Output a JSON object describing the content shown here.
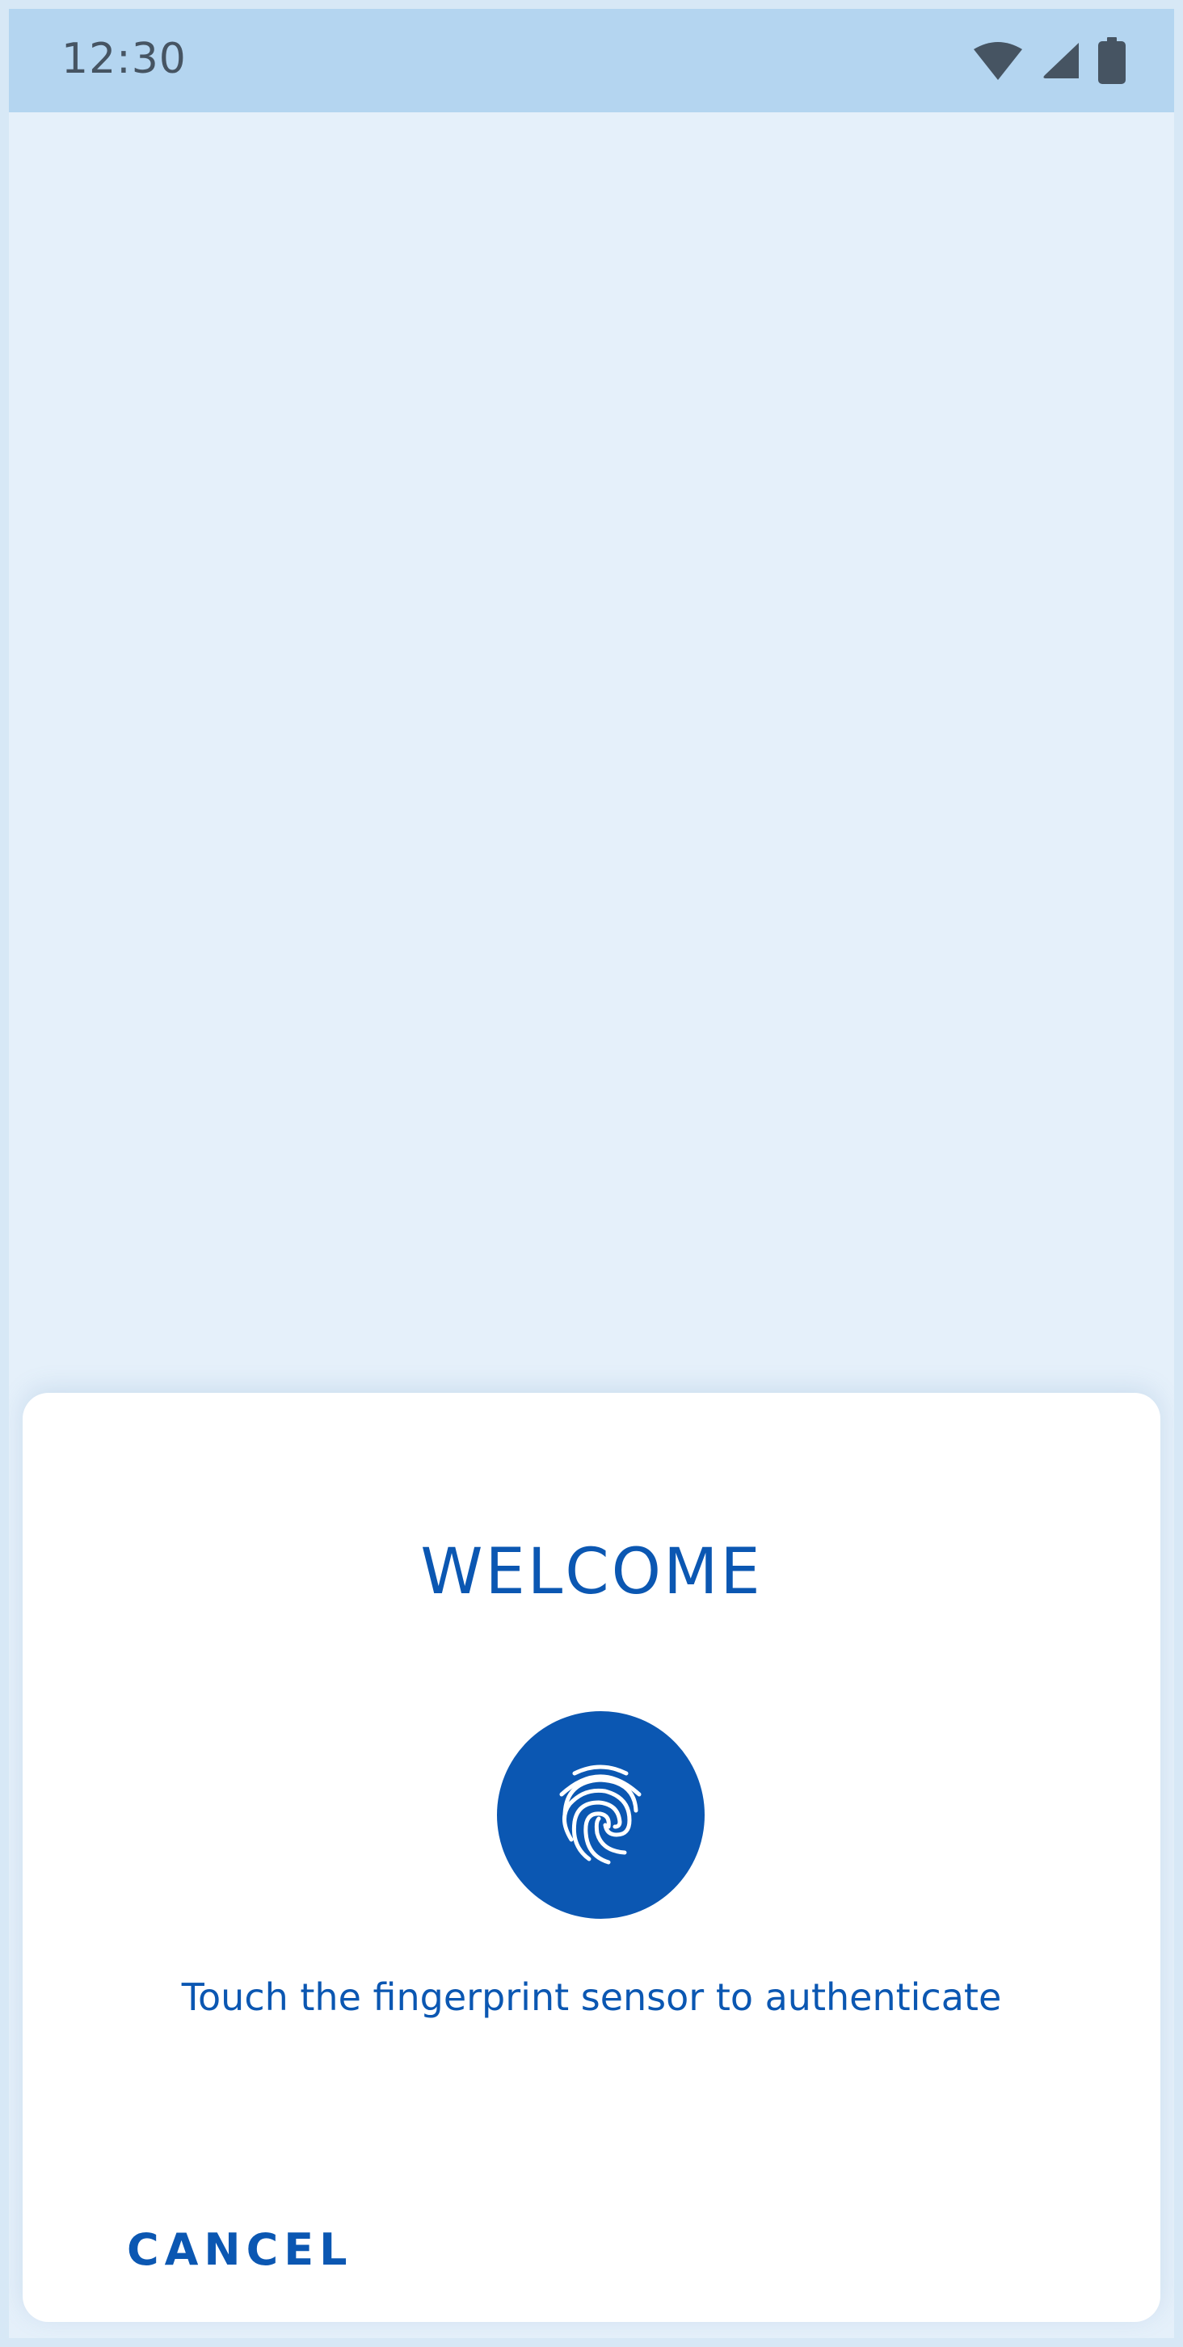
{
  "status_bar": {
    "time": "12:30",
    "icons": [
      "wifi-icon",
      "cellular-signal-icon",
      "battery-icon"
    ]
  },
  "dialog": {
    "title": "WELCOME",
    "icon": "fingerprint-icon",
    "message": "Touch the fingerprint sensor to authenticate",
    "cancel_label": "CANCEL"
  },
  "colors": {
    "accent": "#0b57b2",
    "status_bar_bg": "#b4d5f0",
    "screen_bg": "#e5f0fa",
    "status_icon": "#465462",
    "sheet_bg": "#ffffff"
  }
}
